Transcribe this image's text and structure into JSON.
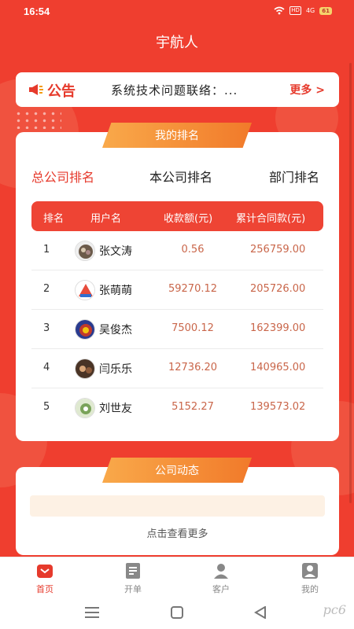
{
  "status_bar": {
    "time": "16:54",
    "hd": "HD",
    "signal": "4G",
    "battery": "61"
  },
  "app_title": "宇航人",
  "notice": {
    "tag": "公告",
    "text": "系统技术问题联络：...",
    "more": "更多 >"
  },
  "ranking": {
    "section_title": "我的排名",
    "tabs": [
      "总公司排名",
      "本公司排名",
      "部门排名"
    ],
    "active_tab": 0,
    "columns": [
      "排名",
      "用户名",
      "收款额(元)",
      "累计合同款(元)"
    ],
    "rows": [
      {
        "rank": "1",
        "name": "张文涛",
        "amount": "0.56",
        "total": "256759.00"
      },
      {
        "rank": "2",
        "name": "张萌萌",
        "amount": "59270.12",
        "total": "205726.00"
      },
      {
        "rank": "3",
        "name": "吴俊杰",
        "amount": "7500.12",
        "total": "162399.00"
      },
      {
        "rank": "4",
        "name": "闫乐乐",
        "amount": "12736.20",
        "total": "140965.00"
      },
      {
        "rank": "5",
        "name": "刘世友",
        "amount": "5152.27",
        "total": "139573.02"
      }
    ]
  },
  "news": {
    "section_title": "公司动态",
    "more": "点击查看更多"
  },
  "tabbar": {
    "items": [
      {
        "label": "首页",
        "icon": "home-icon"
      },
      {
        "label": "开单",
        "icon": "order-icon"
      },
      {
        "label": "客户",
        "icon": "customer-icon"
      },
      {
        "label": "我的",
        "icon": "profile-icon"
      }
    ],
    "active": 0
  },
  "watermark": "pc6",
  "colors": {
    "brand_red": "#ef3e2f",
    "accent_orange": "#f17a2a",
    "amount_text": "#c9664a"
  }
}
